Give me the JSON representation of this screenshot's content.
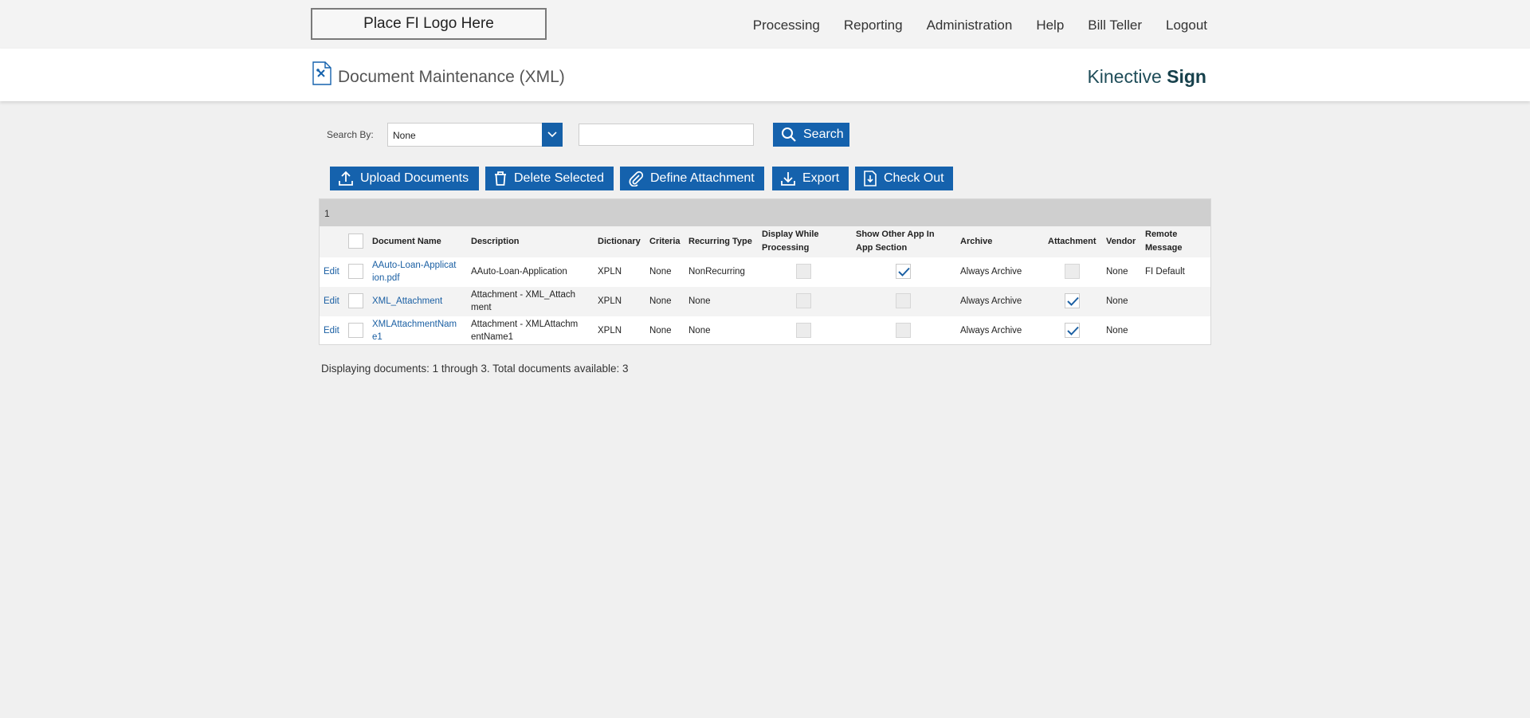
{
  "topbar": {
    "logo_text": "Place FI Logo Here",
    "nav": [
      "Processing",
      "Reporting",
      "Administration",
      "Help",
      "Bill Teller",
      "Logout"
    ]
  },
  "header": {
    "title": "Document Maintenance (XML)",
    "brand_light": "Kinective",
    "brand_bold": "Sign",
    "accent_color": "#1562ad"
  },
  "search": {
    "label": "Search By:",
    "selected": "None",
    "input_value": "",
    "button": "Search"
  },
  "toolbar": {
    "upload": "Upload Documents",
    "delete": "Delete Selected",
    "define": "Define Attachment",
    "export": "Export",
    "checkout": "Check Out"
  },
  "table": {
    "page": "1",
    "headers": {
      "name": "Document Name",
      "description": "Description",
      "dictionary": "Dictionary",
      "criteria": "Criteria",
      "recurring": "Recurring Type",
      "display_l1": "Display While",
      "display_l2": "Processing",
      "show_l1": "Show Other App In",
      "show_l2": "App Section",
      "archive": "Archive",
      "attachment": "Attachment",
      "vendor": "Vendor",
      "remote_l1": "Remote",
      "remote_l2": "Message"
    },
    "rows": [
      {
        "edit": "Edit",
        "name_l1": "AAuto-Loan-Applicat",
        "name_l2": "ion.pdf",
        "desc_l1": "AAuto-Loan-Application",
        "desc_l2": "",
        "dictionary": "XPLN",
        "criteria": "None",
        "recurring": "NonRecurring",
        "display_while_processing": false,
        "show_other_app": true,
        "archive": "Always Archive",
        "attachment": false,
        "vendor": "None",
        "remote_message": "FI Default"
      },
      {
        "edit": "Edit",
        "name_l1": "XML_Attachment",
        "name_l2": "",
        "desc_l1": "Attachment - XML_Attach",
        "desc_l2": "ment",
        "dictionary": "XPLN",
        "criteria": "None",
        "recurring": "None",
        "display_while_processing": false,
        "show_other_app": false,
        "archive": "Always Archive",
        "attachment": true,
        "vendor": "None",
        "remote_message": ""
      },
      {
        "edit": "Edit",
        "name_l1": "XMLAttachmentNam",
        "name_l2": "e1",
        "desc_l1": "Attachment - XMLAttachm",
        "desc_l2": "entName1",
        "dictionary": "XPLN",
        "criteria": "None",
        "recurring": "None",
        "display_while_processing": false,
        "show_other_app": false,
        "archive": "Always Archive",
        "attachment": true,
        "vendor": "None",
        "remote_message": ""
      }
    ]
  },
  "footer": {
    "summary": "Displaying documents: 1 through 3. Total documents available: 3"
  }
}
